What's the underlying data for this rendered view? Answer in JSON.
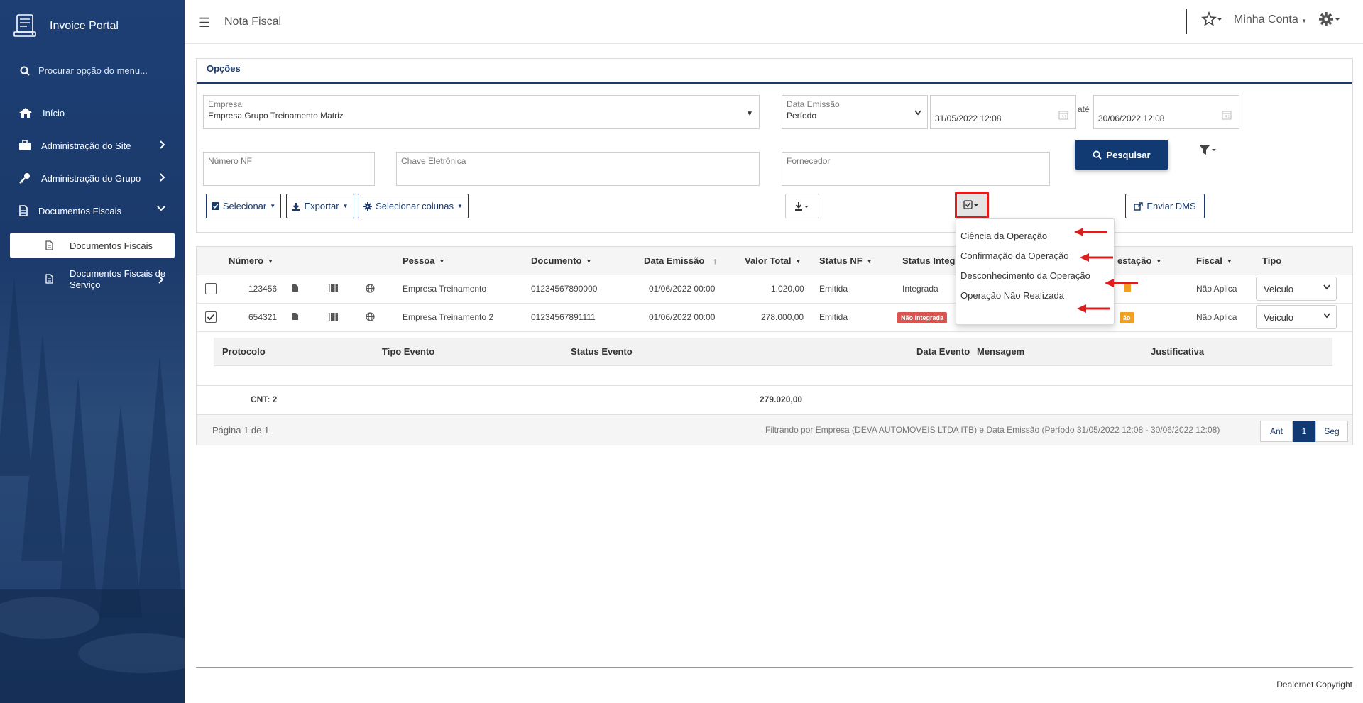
{
  "app": {
    "name": "Invoice Portal",
    "page_title": "Nota Fiscal"
  },
  "sidebar": {
    "search_placeholder": "Procurar opção do menu...",
    "items": [
      {
        "label": "Início",
        "icon": "home-icon"
      },
      {
        "label": "Administração do Site",
        "icon": "briefcase-icon"
      },
      {
        "label": "Administração do Grupo",
        "icon": "key-icon"
      },
      {
        "label": "Documentos Fiscais",
        "icon": "document-icon"
      }
    ],
    "subitems": [
      {
        "label": "Documentos Fiscais",
        "active": true
      },
      {
        "label_line1": "Documentos Fiscais de",
        "label_line2": "Serviço"
      }
    ]
  },
  "topbar": {
    "account_label": "Minha Conta"
  },
  "options": {
    "title": "Opções",
    "empresa": {
      "label": "Empresa",
      "value": "Empresa Grupo Treinamento Matriz"
    },
    "data_emissao": {
      "label": "Data Emissão",
      "value": "Período"
    },
    "date_from": "31/05/2022 12:08",
    "ate": "até",
    "date_to": "30/06/2022 12:08",
    "numero_nf": {
      "label": "Número NF"
    },
    "chave": {
      "label": "Chave Eletrônica"
    },
    "fornecedor": {
      "label": "Fornecedor"
    },
    "search_button": "Pesquisar",
    "selecionar": "Selecionar",
    "exportar": "Exportar",
    "selecionar_colunas": "Selecionar colunas",
    "enviar_dms": "Enviar DMS"
  },
  "dropdown": {
    "items": [
      "Ciência da Operação",
      "Confirmação da Operação",
      "Desconhecimento da Operação",
      "Operação Não Realizada"
    ]
  },
  "table": {
    "headers": {
      "numero": "Número",
      "pessoa": "Pessoa",
      "documento": "Documento",
      "data_emissao": "Data Emissão",
      "valor_total": "Valor Total",
      "status_nf": "Status NF",
      "status_integ": "Status Integr",
      "manifestacao": "estação",
      "fiscal": "Fiscal",
      "tipo": "Tipo"
    },
    "rows": [
      {
        "checked": false,
        "numero": "123456",
        "pessoa": "Empresa Treinamento",
        "documento": "01234567890000",
        "data": "01/06/2022 00:00",
        "valor": "1.020,00",
        "status_nf": "Emitida",
        "status_integ": "Integrada",
        "manif_badge": "",
        "fiscal": "Não Aplica",
        "tipo": "Veiculo"
      },
      {
        "checked": true,
        "numero": "654321",
        "pessoa": "Empresa Treinamento 2",
        "documento": "01234567891111",
        "data": "01/06/2022 00:00",
        "valor": "278.000,00",
        "status_nf": "Emitida",
        "status_integ": "Não Integrada",
        "manif_badge": "ão",
        "fiscal": "Não Aplica",
        "tipo": "Veiculo"
      }
    ],
    "sub_headers": {
      "protocolo": "Protocolo",
      "tipo_evento": "Tipo Evento",
      "status_evento": "Status Evento",
      "data_evento": "Data Evento",
      "mensagem": "Mensagem",
      "justificativa": "Justificativa"
    },
    "totals": {
      "count": "CNT: 2",
      "sum": "279.020,00"
    },
    "footer": {
      "page_info": "Página 1 de 1",
      "filter_info": "Filtrando por Empresa (DEVA AUTOMOVEIS LTDA ITB) e Data Emissão (Período 31/05/2022 12:08 - 30/06/2022 12:08)",
      "prev": "Ant",
      "current": "1",
      "next": "Seg"
    }
  },
  "copyright": "Dealernet Copyright",
  "colors": {
    "primary": "#113a72",
    "sidebar": "#1b3a6b",
    "highlight": "#e01c1c",
    "badge_red": "#d9534f",
    "badge_orange": "#f0a020"
  }
}
